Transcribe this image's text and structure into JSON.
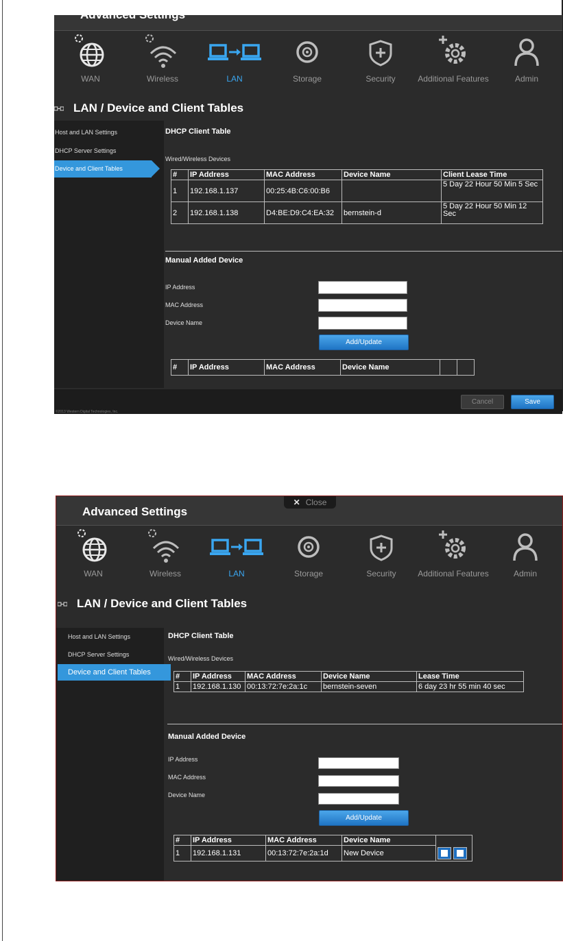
{
  "header": {
    "title": "Advanced Settings",
    "close_label": "Close"
  },
  "nav": [
    {
      "label": "WAN",
      "icon": "globe-gear-icon",
      "active": false
    },
    {
      "label": "Wireless",
      "icon": "wifi-gear-icon",
      "active": false
    },
    {
      "label": "LAN",
      "icon": "lan-computers-icon",
      "active": true
    },
    {
      "label": "Storage",
      "icon": "disc-icon",
      "active": false
    },
    {
      "label": "Security",
      "icon": "shield-plus-icon",
      "active": false
    },
    {
      "label": "Additional Features",
      "icon": "gear-plus-icon",
      "active": false
    },
    {
      "label": "Admin",
      "icon": "person-icon",
      "active": false
    }
  ],
  "section_title": "LAN / Device and Client Tables",
  "sidebar": {
    "items": [
      {
        "label": "Host and LAN Settings",
        "active": false
      },
      {
        "label": "DHCP Server Settings",
        "active": false
      },
      {
        "label": "Device and Client Tables",
        "active": true
      }
    ]
  },
  "dhcp": {
    "title": "DHCP Client Table",
    "subtitle": "Wired/Wireless Devices"
  },
  "panel1": {
    "client_table": {
      "headers": [
        "#",
        "IP Address",
        "MAC Address",
        "Device Name",
        "Client Lease Time"
      ],
      "rows": [
        [
          "1",
          "192.168.1.137",
          "00:25:4B:C6:00:B6",
          "",
          "5 Day 22 Hour 50 Min 5 Sec"
        ],
        [
          "2",
          "192.168.1.138",
          "D4:BE:D9:C4:EA:32",
          "bernstein-d",
          "5 Day 22 Hour 50 Min 12 Sec"
        ]
      ]
    },
    "manual_table": {
      "headers": [
        "#",
        "IP Address",
        "MAC Address",
        "Device Name",
        "",
        ""
      ]
    },
    "cancel_label": "Cancel",
    "save_label": "Save",
    "copyright": "©2013 Western Digital Technologies, Inc."
  },
  "panel2": {
    "client_table": {
      "headers": [
        "#",
        "IP Address",
        "MAC Address",
        "Device Name",
        "Lease Time"
      ],
      "rows": [
        [
          "1",
          "192.168.1.130",
          "00:13:72:7e:2a:1c",
          "bernstein-seven",
          "6 day 23 hr 55 min 40 sec"
        ]
      ]
    },
    "manual_table": {
      "headers": [
        "#",
        "IP Address",
        "MAC Address",
        "Device Name"
      ],
      "rows": [
        [
          "1",
          "192.168.1.131",
          "00:13:72:7e:2a:1d",
          "New Device"
        ]
      ]
    }
  },
  "manual": {
    "title": "Manual Added Device",
    "ip_label": "IP Address",
    "mac_label": "MAC Address",
    "name_label": "Device Name",
    "add_update_label": "Add/Update"
  },
  "colors": {
    "accent": "#3497dc",
    "panel_bg": "#2b2b2b",
    "active_nav": "#3aa6f0",
    "frame_border": "#8b1b1b"
  }
}
